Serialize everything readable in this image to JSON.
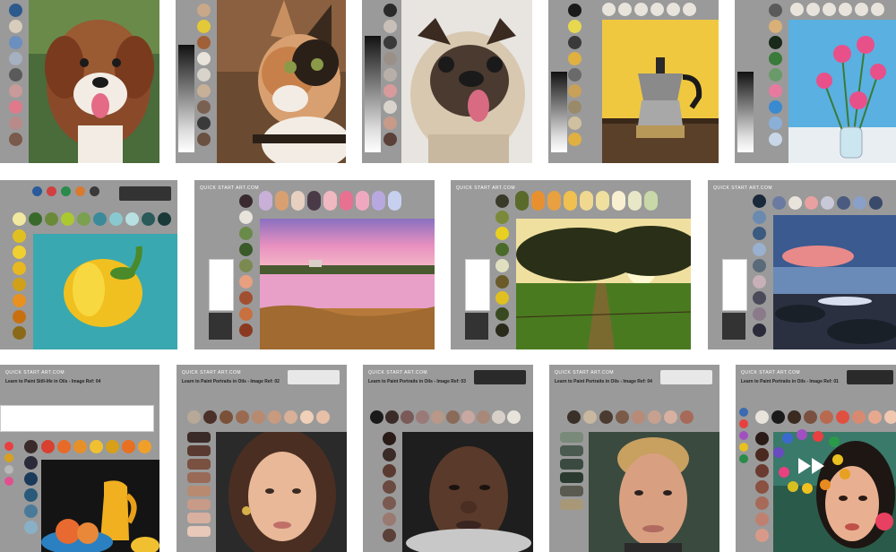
{
  "brand": "QUICK START ART.COM",
  "cards": [
    {
      "subject": "dog"
    },
    {
      "subject": "cat"
    },
    {
      "subject": "pug"
    },
    {
      "subject": "coffee-pot"
    },
    {
      "subject": "flowers"
    },
    {
      "subject": "yellow-pepper"
    },
    {
      "subject": "pink-lake"
    },
    {
      "subject": "sunset-trees"
    },
    {
      "subject": "rocky-shore"
    },
    {
      "title": "Learn to Paint Still-life in Oils - Image Ref: 04"
    },
    {
      "title": "Learn to Paint Portraits in Oils - Image Ref: 02"
    },
    {
      "title": "Learn to Paint Portraits in Oils - Image Ref: 03"
    },
    {
      "title": "Learn to Paint Portraits in Oils - Image Ref: 04"
    },
    {
      "title": "Learn to Paint Portraits in Oils - Image Ref: 01"
    }
  ],
  "play_icon": "fast-forward-icon",
  "colors": {
    "card_bg": "#9a9a9a",
    "page_bg": "#ffffff"
  }
}
